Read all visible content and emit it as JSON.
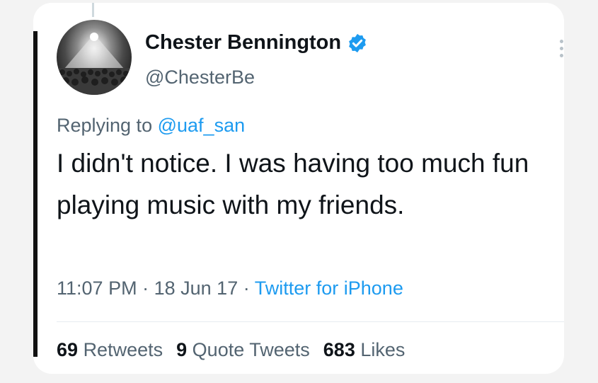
{
  "author": {
    "name": "Chester Bennington",
    "handle": "@ChesterBe",
    "verified": true
  },
  "reply": {
    "prefix": "Replying to",
    "mention": "@uaf_san"
  },
  "tweet": {
    "text": "I didn't notice. I was having too much fun playing music with my friends."
  },
  "meta": {
    "time": "11:07 PM",
    "date": "18 Jun 17",
    "separator": "·",
    "source": "Twitter for iPhone"
  },
  "stats": {
    "retweets_count": "69",
    "retweets_label": "Retweets",
    "quotes_count": "9",
    "quotes_label": "Quote Tweets",
    "likes_count": "683",
    "likes_label": "Likes"
  },
  "colors": {
    "accent": "#1d9bf0",
    "text": "#0f1419",
    "secondary": "#536471"
  },
  "icons": {
    "verified": "verified-badge-icon",
    "more": "more-options-icon"
  }
}
